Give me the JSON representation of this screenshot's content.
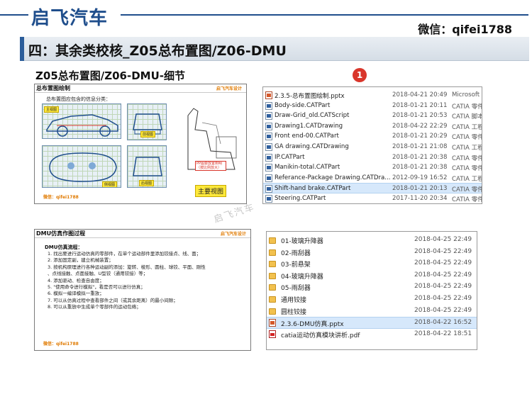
{
  "header": {
    "brand": "启飞汽车",
    "wechat": "微信：qifei1788"
  },
  "section_title": "四：其余类校核_Z05总布置图/Z06-DMU",
  "subtitle": "Z05总布置图/Z06-DMU-细节",
  "badge": "1",
  "watermark": "启飞汽车",
  "slide1": {
    "title": "总布置图绘制",
    "brand": "启飞汽车设计",
    "intro": "总布置图应包含的信息分类：",
    "labels": {
      "main_view": "主视图",
      "front_view": "前视图",
      "side_view": "侧视图",
      "rear_view": "后视图",
      "main_big": "主要视图",
      "note": "PP图要放置到明（按比例放大）"
    },
    "footer": "微信：qifei1788"
  },
  "slide2": {
    "title": "DMU仿真作图过程",
    "brand": "启飞汽车设计",
    "heading": "DMU仿真流程：",
    "steps": [
      "1.  找出要进行运动仿真的零部件，在单个运动部件里添加铰接点、线、面；",
      "2.  添加固定副，建立机械装置；",
      "3.  按机构原理进行各种运动副的添加：旋转、棱形、圆柱、球铰、平面、刚性",
      "     、点线接触、点面接触、U型铰（通用铰接）等；",
      "4.  添加驱动、检查自由度；",
      "5.  \"使用命令进行模拟\"，看是否可以进行仿真；",
      "6.  模拟一编译模拟一重放；",
      "7.  可以从仿真过程中查看部件之间（或其余距离）的最小间隙；",
      "8.  可以从重放中生成单个零部件的运动包络；"
    ],
    "footer": "微信：qifei1788"
  },
  "explorer1": {
    "rows": [
      {
        "icon": "ppt",
        "name": "2.3.5-总布置图绘制.pptx",
        "date": "2018-04-21 20:49",
        "type": "Microsoft",
        "selected": false
      },
      {
        "icon": "doc",
        "name": "Body-side.CATPart",
        "date": "2018-01-21 20:11",
        "type": "CATIA 零件",
        "selected": false
      },
      {
        "icon": "doc",
        "name": "Draw-Grid_old.CATScript",
        "date": "2018-01-21 20:53",
        "type": "CATIA 脚本",
        "selected": false
      },
      {
        "icon": "doc",
        "name": "Drawing1.CATDrawing",
        "date": "2018-04-22 22:29",
        "type": "CATIA 工程",
        "selected": false
      },
      {
        "icon": "doc",
        "name": "Front end-00.CATPart",
        "date": "2018-01-21 20:29",
        "type": "CATIA 零件",
        "selected": false
      },
      {
        "icon": "doc",
        "name": "GA drawing.CATDrawing",
        "date": "2018-01-21 21:08",
        "type": "CATIA 工程",
        "selected": false
      },
      {
        "icon": "doc",
        "name": "IP.CATPart",
        "date": "2018-01-21 20:38",
        "type": "CATIA 零件",
        "selected": false
      },
      {
        "icon": "doc",
        "name": "Manikin-total.CATPart",
        "date": "2018-01-21 20:38",
        "type": "CATIA 零件",
        "selected": false
      },
      {
        "icon": "doc",
        "name": "Referance-Package Drawing.CATDra...",
        "date": "2012-09-19 16:52",
        "type": "CATIA 工程",
        "selected": false
      },
      {
        "icon": "doc",
        "name": "Shift-hand brake.CATPart",
        "date": "2018-01-21 20:13",
        "type": "CATIA 零件",
        "selected": true
      },
      {
        "icon": "doc",
        "name": "Steering.CATPart",
        "date": "2017-11-20 20:34",
        "type": "CATIA 零件",
        "selected": false
      }
    ]
  },
  "explorer2": {
    "rows": [
      {
        "icon": "folder",
        "name": "01-玻璃升降器",
        "date": "2018-04-25 22:49",
        "selected": false
      },
      {
        "icon": "folder",
        "name": "02-雨刮器",
        "date": "2018-04-25 22:49",
        "selected": false
      },
      {
        "icon": "folder",
        "name": "03-前悬架",
        "date": "2018-04-25 22:49",
        "selected": false
      },
      {
        "icon": "folder",
        "name": "04-玻璃升降器",
        "date": "2018-04-25 22:49",
        "selected": false
      },
      {
        "icon": "folder",
        "name": "05-雨刮器",
        "date": "2018-04-25 22:49",
        "selected": false
      },
      {
        "icon": "folder",
        "name": "通用铰接",
        "date": "2018-04-25 22:49",
        "selected": false
      },
      {
        "icon": "folder",
        "name": "圆柱铰接",
        "date": "2018-04-25 22:49",
        "selected": false
      },
      {
        "icon": "ppt",
        "name": "2.3.6-DMU仿真.pptx",
        "date": "2018-04-22 16:52",
        "selected": true
      },
      {
        "icon": "pdf",
        "name": "catia运动仿真模块讲析.pdf",
        "date": "2018-04-22 18:51",
        "selected": false
      }
    ]
  }
}
